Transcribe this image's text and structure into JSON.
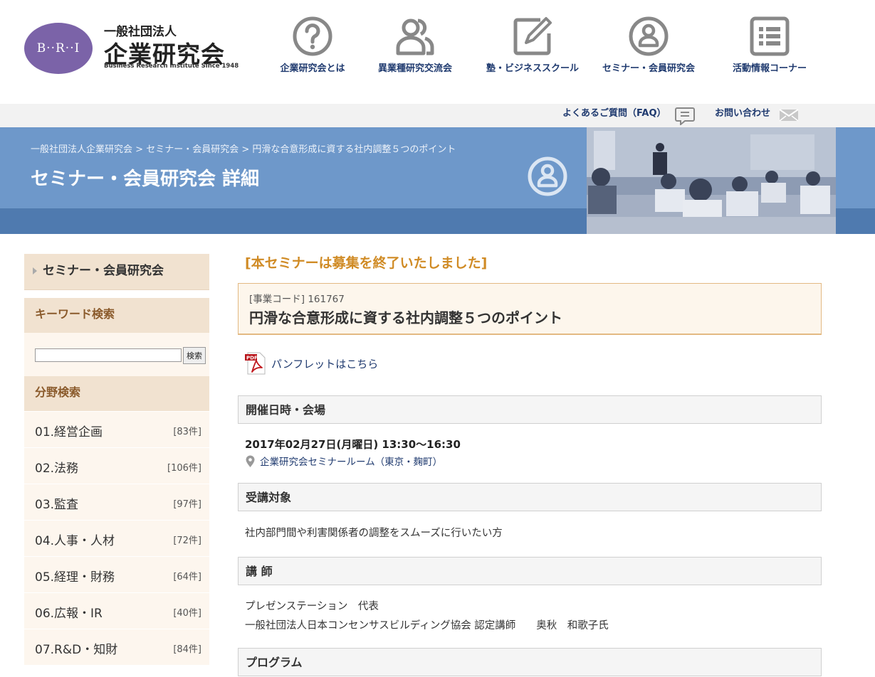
{
  "header": {
    "logo": {
      "oval_text": "B··R··I",
      "pre": "一般社団法人",
      "main": "企業研究会",
      "sub": "Business Research Institute Since 1948"
    },
    "nav": [
      {
        "label": "企業研究会とは",
        "icon": "question-circle-icon"
      },
      {
        "label": "異業種研究交流会",
        "icon": "people-group-icon"
      },
      {
        "label": "塾・ビジネススクール",
        "icon": "pencil-note-icon"
      },
      {
        "label": "セミナー・会員研究会",
        "icon": "person-circle-icon"
      },
      {
        "label": "活動情報コーナー",
        "icon": "list-icon"
      }
    ]
  },
  "utility": {
    "faq": "よくあるご質問（FAQ）",
    "contact": "お問い合わせ"
  },
  "banner": {
    "breadcrumb": [
      "一般社団法人企業研究会",
      "セミナー・会員研究会",
      "円滑な合意形成に資する社内調整５つのポイント"
    ],
    "separator": ">",
    "title": "セミナー・会員研究会 詳細"
  },
  "sidebar": {
    "title": "セミナー・会員研究会",
    "keyword_heading": "キーワード検索",
    "search_value": "",
    "search_button": "検索",
    "category_heading": "分野検索",
    "categories": [
      {
        "label": "01.経営企画",
        "count": "[83件]"
      },
      {
        "label": "02.法務",
        "count": "[106件]"
      },
      {
        "label": "03.監査",
        "count": "[97件]"
      },
      {
        "label": "04.人事・人材",
        "count": "[72件]"
      },
      {
        "label": "05.経理・財務",
        "count": "[64件]"
      },
      {
        "label": "06.広報・IR",
        "count": "[40件]"
      },
      {
        "label": "07.R&D・知財",
        "count": "[84件]"
      }
    ]
  },
  "main": {
    "closed_notice": "[本セミナーは募集を終了いたしました]",
    "code_label": "[事業コード] 161767",
    "seminar_title": "円滑な合意形成に資する社内調整５つのポイント",
    "pamphlet": "パンフレットはこちら",
    "pdf_label": "PDF",
    "sections": {
      "datetime": {
        "heading": "開催日時・会場",
        "date": "2017年02月27日(月曜日) 13:30～16:30",
        "venue": "企業研究会セミナールーム（東京・麹町）"
      },
      "target": {
        "heading": "受講対象",
        "text": "社内部門間や利害関係者の調整をスムーズに行いたい方"
      },
      "lecturer": {
        "heading": "講 師",
        "line1": "プレゼンステーション　代表",
        "line2": "一般社団法人日本コンセンサスビルディング協会 認定講師　　奥秋　和歌子氏"
      },
      "program": {
        "heading": "プログラム"
      }
    }
  }
}
